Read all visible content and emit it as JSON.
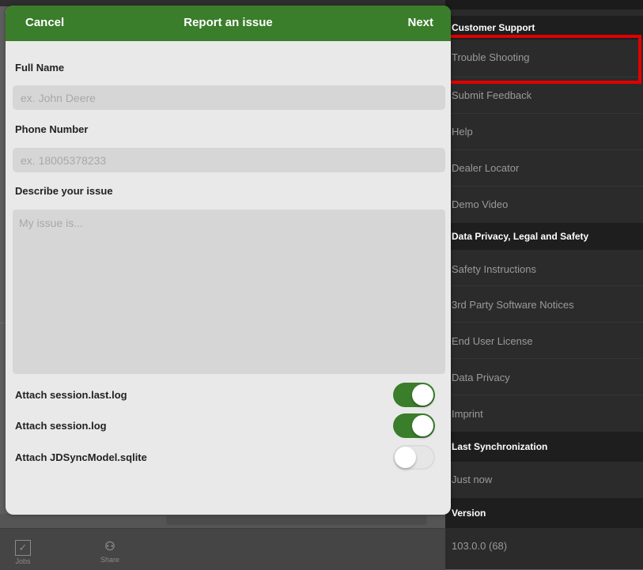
{
  "background_app": {
    "tabs": [
      {
        "label": "Jobs",
        "icon": "checkbox-icon"
      },
      {
        "label": "Share",
        "icon": "people-icon"
      }
    ]
  },
  "settings_panel": {
    "sections": [
      {
        "header": "Customer Support",
        "items": [
          "Trouble Shooting",
          "Submit Feedback",
          "Help",
          "Dealer Locator",
          "Demo Video"
        ]
      },
      {
        "header": "Data Privacy, Legal and Safety",
        "items": [
          "Safety Instructions",
          "3rd Party Software Notices",
          "End User License",
          "Data Privacy",
          "Imprint"
        ]
      },
      {
        "header": "Last Synchronization",
        "items": [
          "Just now"
        ]
      },
      {
        "header": "Version",
        "items": [
          "103.0.0 (68)"
        ]
      }
    ]
  },
  "modal": {
    "cancel_label": "Cancel",
    "title": "Report an issue",
    "next_label": "Next",
    "full_name_label": "Full Name",
    "full_name_placeholder": "ex. John Deere",
    "full_name_value": "",
    "phone_label": "Phone Number",
    "phone_placeholder": "ex. 18005378233",
    "phone_value": "",
    "issue_label": "Describe your issue",
    "issue_placeholder": "My issue is...",
    "issue_value": "",
    "toggles": [
      {
        "label": "Attach session.last.log",
        "on": true
      },
      {
        "label": "Attach session.log",
        "on": true
      },
      {
        "label": "Attach JDSyncModel.sqlite",
        "on": false
      }
    ]
  },
  "colors": {
    "accent_green": "#3a7d2b",
    "highlight_red": "#e00000",
    "panel_dark": "#2b2b2b"
  }
}
